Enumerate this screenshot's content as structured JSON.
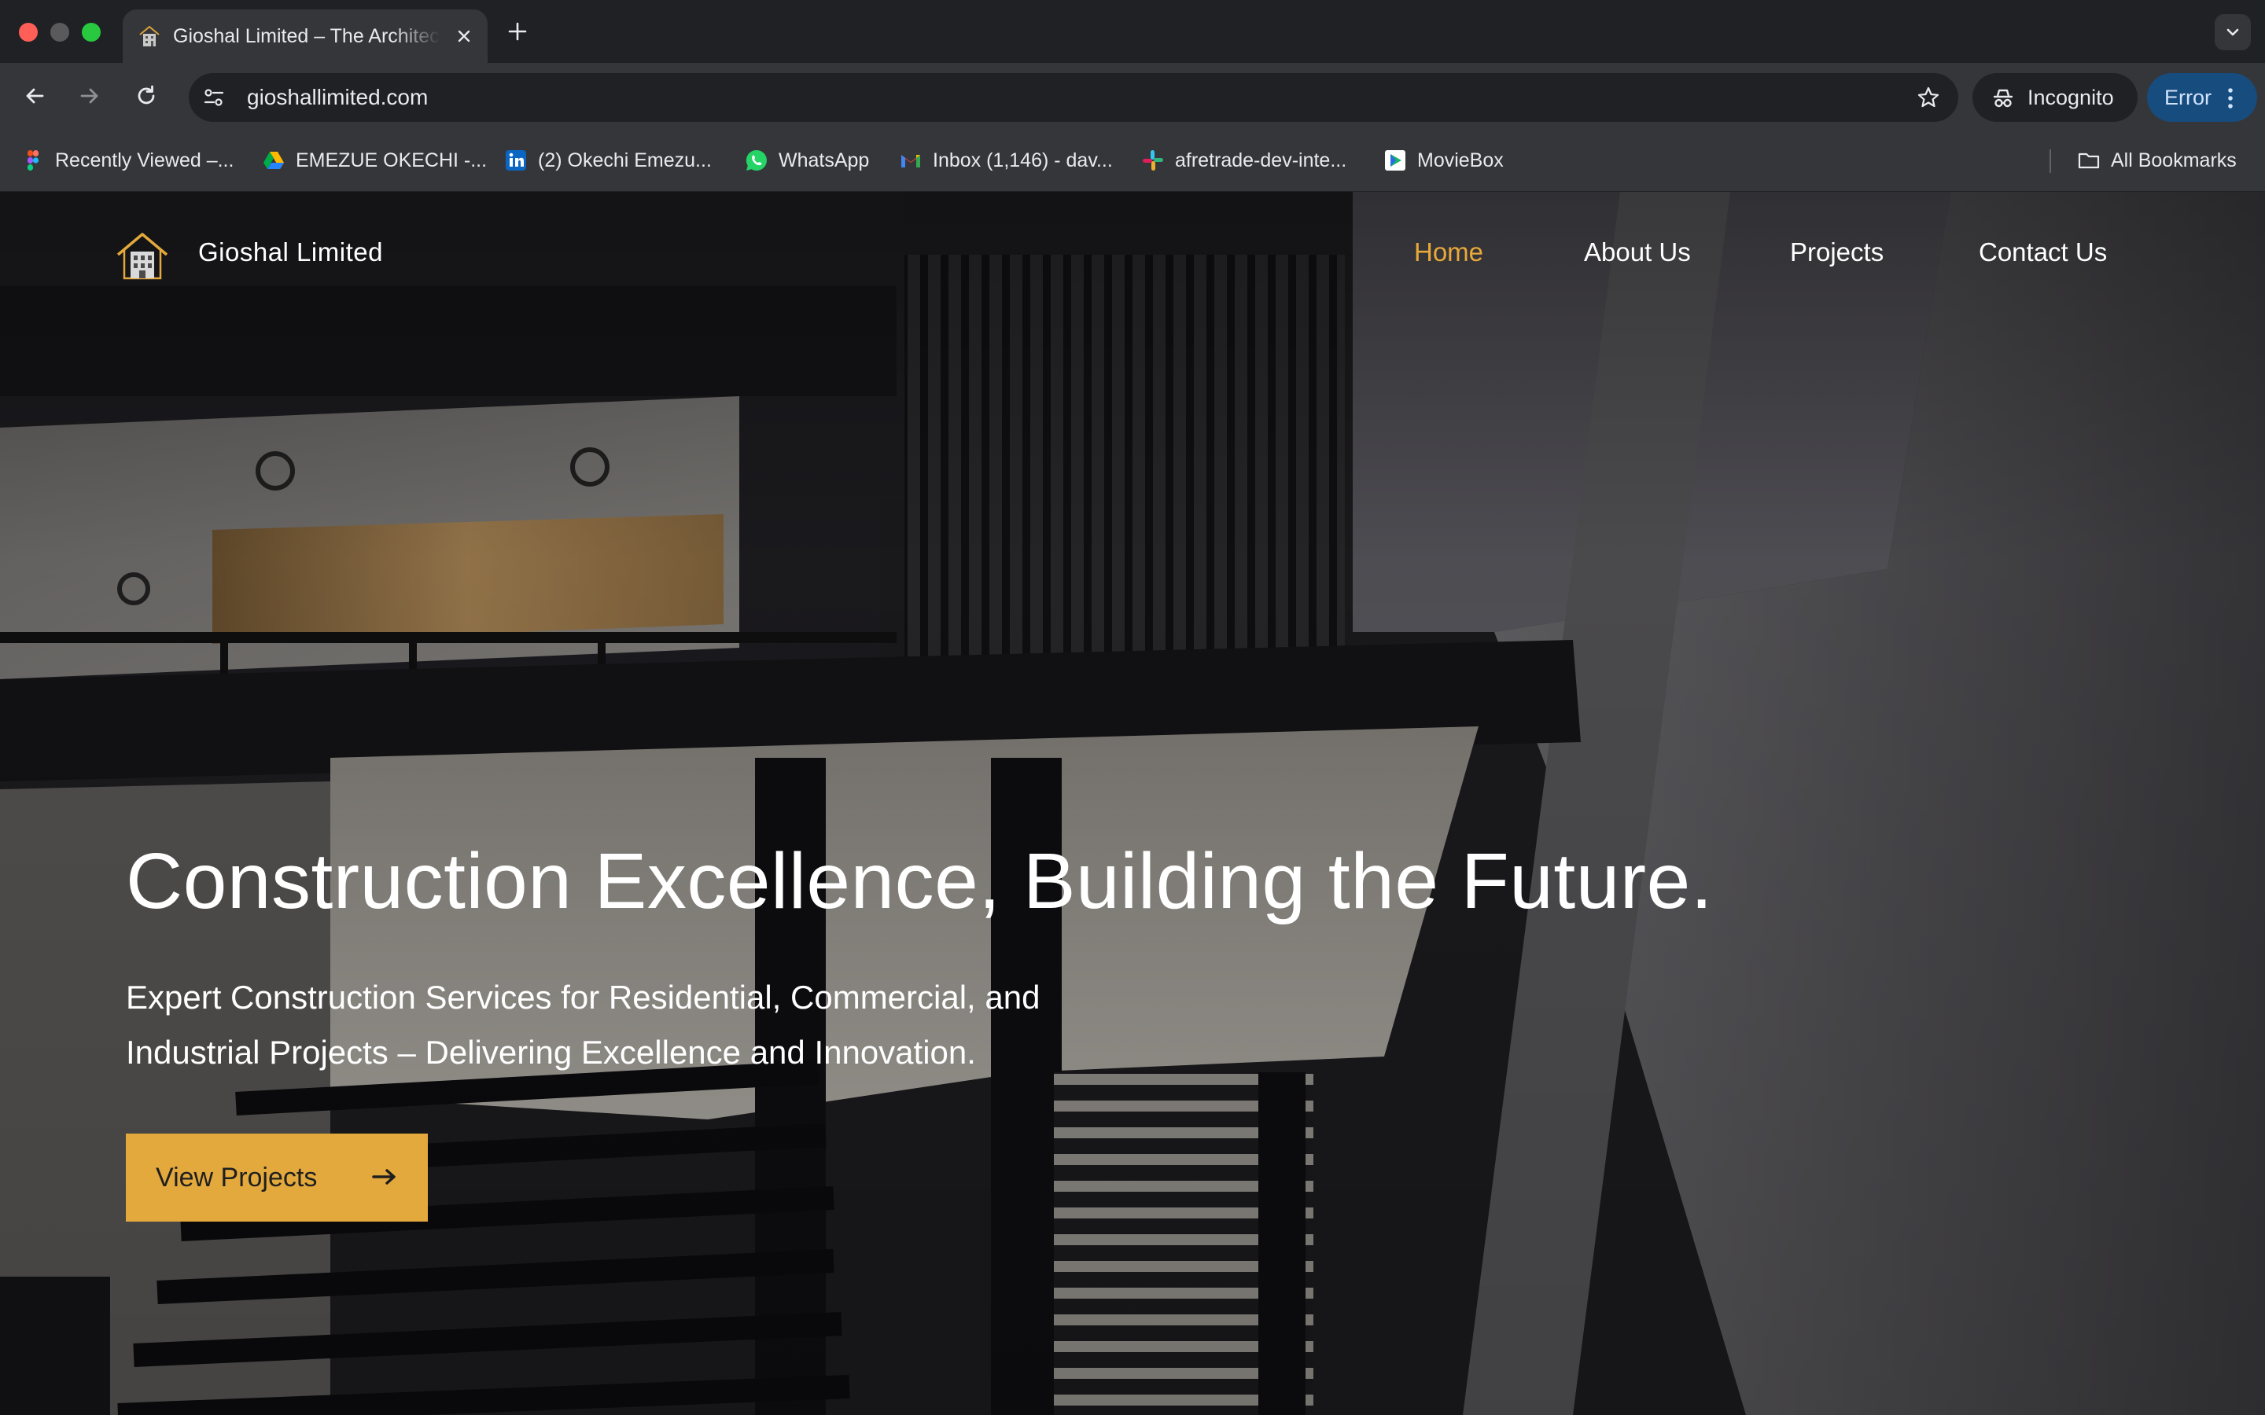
{
  "browser": {
    "tab": {
      "title": "Gioshal Limited – The Architecture"
    },
    "omnibox": {
      "url": "gioshallimited.com"
    },
    "profile_label": "Incognito",
    "error_label": "Error",
    "bookmarks": [
      {
        "label": "Recently Viewed –...",
        "icon": "figma-icon"
      },
      {
        "label": "EMEZUE OKECHI -...",
        "icon": "google-drive-icon"
      },
      {
        "label": "(2) Okechi Emezu...",
        "icon": "linkedin-icon"
      },
      {
        "label": "WhatsApp",
        "icon": "whatsapp-icon"
      },
      {
        "label": "Inbox (1,146) - dav...",
        "icon": "gmail-icon"
      },
      {
        "label": "afretrade-dev-inte...",
        "icon": "slack-icon"
      },
      {
        "label": "MovieBox",
        "icon": "moviebox-icon"
      }
    ],
    "all_bookmarks_label": "All Bookmarks"
  },
  "site": {
    "brand": "Gioshal Limited",
    "nav": [
      {
        "label": "Home",
        "active": true
      },
      {
        "label": "About Us",
        "active": false
      },
      {
        "label": "Projects",
        "active": false
      },
      {
        "label": "Contact Us",
        "active": false
      }
    ],
    "hero": {
      "title": "Construction Excellence, Building the Future.",
      "subtitle": "Expert Construction Services for Residential, Commercial, and Industrial Projects – Delivering Excellence and Innovation.",
      "cta_label": "View Projects"
    },
    "colors": {
      "accent": "#e3a93c",
      "nav_active": "#e8a93a"
    }
  }
}
